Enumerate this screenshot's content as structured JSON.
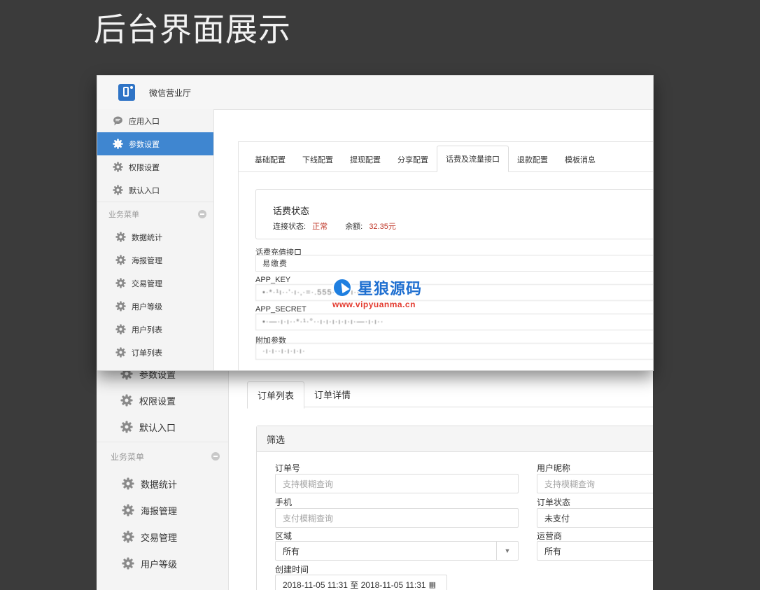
{
  "headline": "后台界面展示",
  "front": {
    "app_title": "微信营业厅",
    "sidebar_top": [
      {
        "label": "应用入口",
        "icon": "chat-bubble-icon"
      },
      {
        "label": "参数设置",
        "icon": "gear-icon",
        "active": true
      },
      {
        "label": "权限设置",
        "icon": "gear-icon"
      },
      {
        "label": "默认入口",
        "icon": "gear-icon"
      }
    ],
    "group_label": "业务菜单",
    "sidebar_sub": [
      "数据统计",
      "海报管理",
      "交易管理",
      "用户等级",
      "用户列表",
      "订单列表"
    ],
    "tabs": [
      "基础配置",
      "下线配置",
      "提现配置",
      "分享配置",
      "话费及流量接口",
      "退款配置",
      "模板消息"
    ],
    "active_tab": "话费及流量接口",
    "status": {
      "title": "话费状态",
      "conn_label": "连接状态:",
      "conn_value": "正常",
      "balance_label": "余额:",
      "balance_value": "32.35元"
    },
    "fields": [
      {
        "label": "话费充值接口",
        "value": "易缴费",
        "masked": false
      },
      {
        "label": "APP_KEY",
        "value": "•·*·¹ı··'·ı·‚·=·.555··ı·ı·ı·ı·ı·ı·ı·",
        "masked": true
      },
      {
        "label": "APP_SECRET",
        "value": "•·—·ı·ı··*·¹·°··ı·ı·ı·ı·ı·ı·—·ı·ı··",
        "masked": true
      },
      {
        "label": "附加参数",
        "value": "·ı·ı··ı·ı·ı·ı·",
        "masked": true
      }
    ]
  },
  "back": {
    "sidebar_top": [
      "参数设置",
      "权限设置",
      "默认入口"
    ],
    "group_label": "业务菜单",
    "sidebar_sub": [
      "数据统计",
      "海报管理",
      "交易管理",
      "用户等级"
    ],
    "tabs": [
      "订单列表",
      "订单详情"
    ],
    "active_tab": "订单列表",
    "filter": {
      "title": "筛选",
      "order_no_label": "订单号",
      "order_no_placeholder": "支持模糊查询",
      "nickname_label": "用户昵称",
      "nickname_placeholder": "支持模糊查询",
      "phone_label": "手机",
      "phone_placeholder": "支付模糊查询",
      "status_label": "订单状态",
      "status_value": "未支付",
      "region_label": "区域",
      "region_value": "所有",
      "carrier_label": "运营商",
      "carrier_value": "所有",
      "created_label": "创建时间",
      "created_value": "2018-11-05 11:31 至 2018-11-05 11:31"
    }
  },
  "watermark": {
    "name": "星狼源码",
    "url": "www.vipyuanma.cn"
  },
  "colors": {
    "active_menu": "#3f86d0",
    "status_red": "#c0392b",
    "backdrop": "#3b3b3b"
  }
}
